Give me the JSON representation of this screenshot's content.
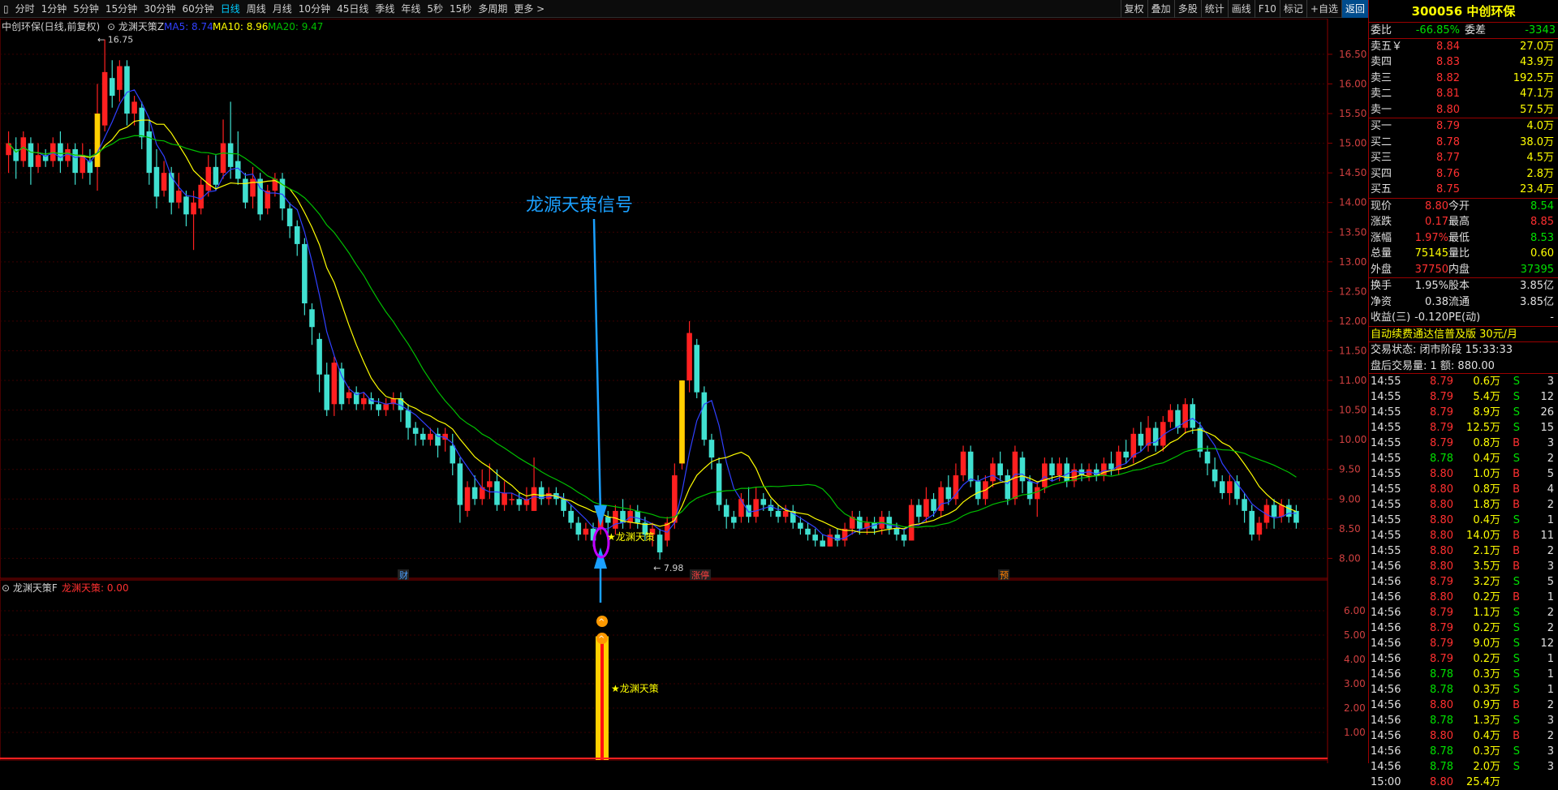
{
  "toolbar": {
    "left_icon": "▯",
    "periods": [
      "分时",
      "1分钟",
      "5分钟",
      "15分钟",
      "30分钟",
      "60分钟",
      "日线",
      "周线",
      "月线",
      "10分钟",
      "45日线",
      "季线",
      "年线",
      "5秒",
      "15秒",
      "多周期",
      "更多 >"
    ],
    "active": "日线",
    "right": [
      "复权",
      "叠加",
      "多股",
      "统计",
      "画线",
      "F10",
      "标记",
      "+自选",
      "返回"
    ]
  },
  "chart": {
    "header_name": "中创环保(日线,前复权)",
    "indicator_name": "龙渊天策Z",
    "ma5_label": "MA5: 8.74",
    "ma10_label": "MA10: 8.96",
    "ma20_label": "MA20: 9.47",
    "high_marker": "16.75",
    "low_marker": "7.98",
    "annotation": "龙源天策信号",
    "signal_label": "★龙渊天策",
    "event_tags": [
      "财",
      "涨停",
      "预"
    ],
    "y_ticks": [
      "16.50",
      "16.00",
      "15.50",
      "15.00",
      "14.50",
      "14.00",
      "13.50",
      "13.00",
      "12.50",
      "12.00",
      "11.50",
      "11.00",
      "10.50",
      "10.00",
      "9.50",
      "9.00",
      "8.50",
      "8.00"
    ],
    "colors": {
      "up": "#ff2020",
      "down": "#40e0d0",
      "ma5": "#3040ff",
      "ma10": "#ffff00",
      "ma20": "#00c000",
      "grid": "#3a0000",
      "accent": "#1aa0ff"
    }
  },
  "sub": {
    "name": "龙渊天策F",
    "value_label": "龙渊天策: 0.00",
    "signal_label": "★龙渊天策",
    "y_ticks": [
      "6.00",
      "5.00",
      "4.00",
      "3.00",
      "2.00",
      "1.00"
    ]
  },
  "chart_data": {
    "type": "candlestick",
    "title": "中创环保(日线,前复权)",
    "ylim": [
      7.8,
      16.8
    ],
    "candles": [
      [
        14.8,
        15.0,
        14.5,
        15.2
      ],
      [
        14.9,
        14.7,
        14.4,
        15.1
      ],
      [
        14.7,
        15.1,
        14.6,
        15.2
      ],
      [
        15.0,
        14.6,
        14.3,
        15.1
      ],
      [
        14.6,
        14.8,
        14.5,
        15.0
      ],
      [
        14.8,
        14.7,
        14.6,
        14.9
      ],
      [
        14.7,
        15.0,
        14.6,
        15.1
      ],
      [
        15.0,
        14.7,
        14.5,
        15.2
      ],
      [
        14.7,
        14.9,
        14.6,
        15.0
      ],
      [
        14.9,
        14.5,
        14.3,
        15.0
      ],
      [
        14.5,
        14.8,
        14.4,
        15.0
      ],
      [
        14.7,
        14.5,
        14.3,
        14.9
      ],
      [
        14.6,
        15.5,
        14.2,
        16.0
      ],
      [
        15.3,
        16.2,
        15.2,
        16.75
      ],
      [
        16.1,
        15.8,
        15.6,
        16.4
      ],
      [
        15.9,
        16.3,
        15.7,
        16.4
      ],
      [
        16.3,
        15.5,
        15.3,
        16.4
      ],
      [
        15.5,
        15.7,
        15.3,
        15.8
      ],
      [
        15.6,
        15.1,
        14.9,
        15.7
      ],
      [
        15.2,
        14.5,
        14.3,
        15.4
      ],
      [
        14.6,
        14.1,
        13.9,
        14.9
      ],
      [
        14.2,
        14.5,
        14.1,
        14.7
      ],
      [
        14.5,
        14.0,
        13.8,
        14.6
      ],
      [
        14.0,
        14.2,
        13.9,
        14.5
      ],
      [
        14.1,
        13.8,
        13.6,
        14.2
      ],
      [
        13.8,
        14.0,
        13.2,
        14.2
      ],
      [
        13.9,
        14.3,
        13.8,
        14.4
      ],
      [
        14.2,
        14.6,
        14.1,
        14.8
      ],
      [
        14.6,
        14.3,
        14.2,
        14.8
      ],
      [
        14.5,
        15.0,
        14.4,
        15.4
      ],
      [
        15.0,
        14.6,
        14.4,
        15.7
      ],
      [
        14.7,
        14.4,
        14.3,
        15.2
      ],
      [
        14.4,
        14.0,
        13.9,
        14.5
      ],
      [
        14.1,
        14.4,
        13.9,
        14.6
      ],
      [
        14.4,
        13.8,
        13.7,
        14.5
      ],
      [
        13.9,
        14.2,
        13.8,
        14.3
      ],
      [
        14.2,
        14.4,
        14.1,
        14.5
      ],
      [
        14.4,
        13.9,
        13.7,
        14.5
      ],
      [
        13.9,
        13.6,
        13.4,
        14.0
      ],
      [
        13.6,
        13.3,
        13.1,
        13.7
      ],
      [
        13.3,
        12.3,
        12.1,
        13.4
      ],
      [
        12.2,
        11.9,
        11.6,
        12.3
      ],
      [
        11.7,
        11.1,
        10.8,
        11.8
      ],
      [
        11.1,
        10.5,
        10.4,
        11.3
      ],
      [
        10.6,
        11.3,
        10.4,
        11.4
      ],
      [
        11.2,
        10.6,
        10.5,
        11.3
      ],
      [
        10.7,
        10.8,
        10.6,
        10.9
      ],
      [
        10.8,
        10.6,
        10.5,
        10.9
      ],
      [
        10.6,
        10.7,
        10.5,
        10.8
      ],
      [
        10.7,
        10.6,
        10.5,
        10.8
      ],
      [
        10.6,
        10.5,
        10.4,
        10.7
      ],
      [
        10.5,
        10.6,
        10.4,
        10.7
      ],
      [
        10.6,
        10.7,
        10.5,
        10.8
      ],
      [
        10.7,
        10.5,
        10.3,
        10.8
      ],
      [
        10.5,
        10.2,
        10.0,
        10.6
      ],
      [
        10.2,
        10.1,
        9.9,
        10.3
      ],
      [
        10.1,
        10.0,
        9.9,
        10.2
      ],
      [
        10.0,
        10.1,
        9.9,
        10.2
      ],
      [
        10.1,
        9.9,
        9.7,
        10.2
      ],
      [
        10.0,
        10.1,
        9.8,
        10.2
      ],
      [
        9.9,
        9.6,
        9.4,
        10.1
      ],
      [
        9.6,
        8.9,
        8.6,
        9.7
      ],
      [
        8.8,
        9.2,
        8.7,
        9.3
      ],
      [
        9.2,
        9.0,
        8.9,
        9.4
      ],
      [
        9.0,
        9.2,
        8.9,
        9.5
      ],
      [
        9.2,
        9.3,
        9.0,
        9.6
      ],
      [
        9.3,
        8.9,
        8.8,
        9.5
      ],
      [
        8.9,
        9.1,
        8.8,
        9.3
      ],
      [
        9.0,
        9.0,
        8.9,
        9.1
      ],
      [
        9.0,
        8.9,
        8.8,
        9.1
      ],
      [
        8.9,
        9.0,
        8.8,
        9.2
      ],
      [
        8.8,
        9.2,
        8.8,
        9.7
      ],
      [
        9.2,
        9.0,
        8.9,
        9.3
      ],
      [
        9.0,
        9.1,
        8.9,
        9.2
      ],
      [
        9.1,
        9.0,
        8.9,
        9.2
      ],
      [
        9.0,
        8.8,
        8.7,
        9.1
      ],
      [
        8.8,
        8.6,
        8.5,
        8.9
      ],
      [
        8.6,
        8.4,
        8.3,
        8.7
      ],
      [
        8.4,
        8.5,
        8.3,
        8.6
      ],
      [
        8.5,
        8.3,
        8.2,
        8.6
      ],
      [
        8.5,
        8.7,
        8.4,
        8.9
      ],
      [
        8.7,
        8.6,
        8.4,
        8.8
      ],
      [
        8.5,
        8.8,
        8.4,
        8.9
      ],
      [
        8.8,
        8.6,
        8.5,
        9.0
      ],
      [
        8.6,
        8.8,
        8.5,
        8.9
      ],
      [
        8.8,
        8.6,
        8.5,
        8.9
      ],
      [
        8.6,
        8.4,
        8.3,
        8.7
      ],
      [
        8.4,
        8.5,
        8.2,
        8.6
      ],
      [
        8.4,
        8.1,
        7.98,
        8.5
      ],
      [
        8.3,
        8.6,
        8.2,
        8.7
      ],
      [
        8.6,
        9.4,
        8.5,
        9.6
      ],
      [
        9.6,
        11.0,
        9.5,
        11.0
      ],
      [
        11.0,
        11.8,
        10.8,
        12.0
      ],
      [
        11.6,
        10.8,
        10.7,
        11.7
      ],
      [
        10.8,
        10.0,
        9.9,
        10.9
      ],
      [
        10.0,
        9.7,
        9.5,
        10.1
      ],
      [
        9.6,
        8.9,
        8.8,
        9.7
      ],
      [
        8.9,
        8.7,
        8.5,
        9.0
      ],
      [
        8.7,
        8.6,
        8.5,
        8.8
      ],
      [
        8.7,
        9.0,
        8.6,
        9.1
      ],
      [
        8.9,
        8.7,
        8.6,
        9.2
      ],
      [
        8.7,
        9.0,
        8.6,
        9.2
      ],
      [
        9.0,
        8.9,
        8.8,
        9.1
      ],
      [
        8.9,
        8.8,
        8.7,
        9.0
      ],
      [
        8.8,
        8.7,
        8.6,
        8.9
      ],
      [
        8.7,
        8.8,
        8.6,
        8.9
      ],
      [
        8.8,
        8.6,
        8.5,
        8.9
      ],
      [
        8.6,
        8.5,
        8.4,
        8.7
      ],
      [
        8.5,
        8.4,
        8.3,
        8.6
      ],
      [
        8.4,
        8.3,
        8.2,
        8.5
      ],
      [
        8.3,
        8.2,
        8.2,
        8.4
      ],
      [
        8.2,
        8.4,
        8.2,
        8.5
      ],
      [
        8.4,
        8.3,
        8.2,
        8.5
      ],
      [
        8.3,
        8.5,
        8.2,
        8.6
      ],
      [
        8.5,
        8.7,
        8.4,
        8.8
      ],
      [
        8.7,
        8.5,
        8.4,
        8.8
      ],
      [
        8.5,
        8.6,
        8.4,
        8.7
      ],
      [
        8.6,
        8.5,
        8.4,
        8.7
      ],
      [
        8.5,
        8.7,
        8.4,
        8.8
      ],
      [
        8.7,
        8.5,
        8.4,
        8.8
      ],
      [
        8.5,
        8.4,
        8.3,
        8.6
      ],
      [
        8.4,
        8.3,
        8.2,
        8.5
      ],
      [
        8.3,
        8.9,
        8.3,
        9.0
      ],
      [
        8.9,
        8.7,
        8.6,
        9.0
      ],
      [
        8.7,
        9.0,
        8.6,
        9.2
      ],
      [
        9.0,
        8.8,
        8.7,
        9.1
      ],
      [
        8.8,
        9.2,
        8.7,
        9.3
      ],
      [
        9.2,
        9.0,
        8.9,
        9.4
      ],
      [
        9.0,
        9.4,
        8.9,
        9.6
      ],
      [
        9.4,
        9.8,
        9.3,
        9.9
      ],
      [
        9.8,
        9.3,
        9.2,
        9.9
      ],
      [
        9.3,
        9.0,
        8.9,
        9.4
      ],
      [
        9.0,
        9.3,
        8.9,
        9.4
      ],
      [
        9.3,
        9.6,
        9.2,
        9.7
      ],
      [
        9.6,
        9.4,
        9.3,
        9.8
      ],
      [
        9.4,
        9.0,
        8.9,
        9.5
      ],
      [
        9.0,
        9.8,
        8.9,
        9.9
      ],
      [
        9.7,
        9.3,
        9.1,
        9.8
      ],
      [
        9.3,
        9.0,
        8.9,
        9.4
      ],
      [
        9.0,
        9.2,
        8.7,
        9.3
      ],
      [
        9.2,
        9.6,
        9.1,
        9.7
      ],
      [
        9.6,
        9.4,
        9.3,
        9.7
      ],
      [
        9.4,
        9.6,
        9.3,
        9.7
      ],
      [
        9.6,
        9.3,
        9.2,
        9.7
      ],
      [
        9.3,
        9.5,
        9.2,
        9.6
      ],
      [
        9.5,
        9.4,
        9.3,
        9.6
      ],
      [
        9.4,
        9.5,
        9.3,
        9.6
      ],
      [
        9.5,
        9.4,
        9.3,
        9.6
      ],
      [
        9.4,
        9.6,
        9.3,
        9.7
      ],
      [
        9.6,
        9.5,
        9.4,
        9.8
      ],
      [
        9.5,
        9.8,
        9.4,
        9.9
      ],
      [
        9.8,
        9.7,
        9.6,
        10.0
      ],
      [
        9.7,
        10.1,
        9.6,
        10.2
      ],
      [
        10.1,
        9.9,
        9.8,
        10.3
      ],
      [
        9.9,
        10.2,
        9.8,
        10.4
      ],
      [
        10.2,
        9.9,
        9.8,
        10.3
      ],
      [
        9.9,
        10.3,
        9.8,
        10.4
      ],
      [
        10.3,
        10.5,
        10.2,
        10.6
      ],
      [
        10.5,
        10.2,
        10.1,
        10.6
      ],
      [
        10.2,
        10.6,
        10.1,
        10.7
      ],
      [
        10.6,
        10.2,
        10.1,
        10.7
      ],
      [
        10.2,
        9.8,
        9.7,
        10.3
      ],
      [
        9.8,
        9.6,
        9.4,
        9.9
      ],
      [
        9.5,
        9.3,
        9.2,
        9.7
      ],
      [
        9.3,
        9.1,
        9.0,
        9.4
      ],
      [
        9.1,
        9.3,
        8.9,
        9.4
      ],
      [
        9.3,
        9.0,
        8.9,
        9.4
      ],
      [
        9.0,
        8.8,
        8.6,
        9.1
      ],
      [
        8.8,
        8.4,
        8.3,
        8.9
      ],
      [
        8.4,
        8.6,
        8.3,
        8.7
      ],
      [
        8.6,
        8.9,
        8.5,
        9.0
      ],
      [
        8.9,
        8.7,
        8.5,
        9.0
      ],
      [
        8.7,
        8.9,
        8.6,
        9.0
      ],
      [
        8.9,
        8.7,
        8.6,
        9.0
      ],
      [
        8.8,
        8.6,
        8.5,
        8.9
      ]
    ]
  },
  "sidebar": {
    "title": "300056 中创环保",
    "wb": {
      "l1": "委比",
      "v1": "-66.85%",
      "l2": "委差",
      "v2": "-3343"
    },
    "asks": [
      [
        "卖五￥",
        "8.84",
        "27.0万"
      ],
      [
        "卖四",
        "8.83",
        "43.9万"
      ],
      [
        "卖三",
        "8.82",
        "192.5万"
      ],
      [
        "卖二",
        "8.81",
        "47.1万"
      ],
      [
        "卖一",
        "8.80",
        "57.5万"
      ]
    ],
    "bids": [
      [
        "买一",
        "8.79",
        "4.0万"
      ],
      [
        "买二",
        "8.78",
        "38.0万"
      ],
      [
        "买三",
        "8.77",
        "4.5万"
      ],
      [
        "买四",
        "8.76",
        "2.8万"
      ],
      [
        "买五",
        "8.75",
        "23.4万"
      ]
    ],
    "quote": [
      [
        "现价",
        "8.80",
        "今开",
        "8.54"
      ],
      [
        "涨跌",
        "0.17",
        "最高",
        "8.85"
      ],
      [
        "涨幅",
        "1.97%",
        "最低",
        "8.53"
      ],
      [
        "总量",
        "75145",
        "量比",
        "0.60"
      ],
      [
        "外盘",
        "37750",
        "内盘",
        "37395"
      ]
    ],
    "fin": [
      [
        "换手",
        "1.95%",
        "股本",
        "3.85亿"
      ],
      [
        "净资",
        "0.38",
        "流通",
        "3.85亿"
      ],
      [
        "收益(三)",
        "-0.120",
        "PE(动)",
        "-"
      ]
    ],
    "ad": "自动续费通达信普及版  30元/月",
    "status": "交易状态: 闭市阶段 15:33:33",
    "after": "盘后交易量: 1  额: 880.00",
    "ticks": [
      [
        "14:55",
        "8.79",
        "0.6万",
        "S",
        "3"
      ],
      [
        "14:55",
        "8.79",
        "5.4万",
        "S",
        "12"
      ],
      [
        "14:55",
        "8.79",
        "8.9万",
        "S",
        "26"
      ],
      [
        "14:55",
        "8.79",
        "12.5万",
        "S",
        "15"
      ],
      [
        "14:55",
        "8.79",
        "0.8万",
        "B",
        "3"
      ],
      [
        "14:55",
        "8.78",
        "0.4万",
        "S",
        "2"
      ],
      [
        "14:55",
        "8.80",
        "1.0万",
        "B",
        "5"
      ],
      [
        "14:55",
        "8.80",
        "0.8万",
        "B",
        "4"
      ],
      [
        "14:55",
        "8.80",
        "1.8万",
        "B",
        "2"
      ],
      [
        "14:55",
        "8.80",
        "0.4万",
        "S",
        "1"
      ],
      [
        "14:55",
        "8.80",
        "14.0万",
        "B",
        "11"
      ],
      [
        "14:55",
        "8.80",
        "2.1万",
        "B",
        "2"
      ],
      [
        "14:56",
        "8.80",
        "3.5万",
        "B",
        "3"
      ],
      [
        "14:56",
        "8.79",
        "3.2万",
        "S",
        "5"
      ],
      [
        "14:56",
        "8.80",
        "0.2万",
        "B",
        "1"
      ],
      [
        "14:56",
        "8.79",
        "1.1万",
        "S",
        "2"
      ],
      [
        "14:56",
        "8.79",
        "0.2万",
        "S",
        "2"
      ],
      [
        "14:56",
        "8.79",
        "9.0万",
        "S",
        "12"
      ],
      [
        "14:56",
        "8.79",
        "0.2万",
        "S",
        "1"
      ],
      [
        "14:56",
        "8.78",
        "0.3万",
        "S",
        "1"
      ],
      [
        "14:56",
        "8.78",
        "0.3万",
        "S",
        "1"
      ],
      [
        "14:56",
        "8.80",
        "0.9万",
        "B",
        "2"
      ],
      [
        "14:56",
        "8.78",
        "1.3万",
        "S",
        "3"
      ],
      [
        "14:56",
        "8.80",
        "0.4万",
        "B",
        "2"
      ],
      [
        "14:56",
        "8.78",
        "0.3万",
        "S",
        "3"
      ],
      [
        "14:56",
        "8.78",
        "2.0万",
        "S",
        "3"
      ],
      [
        "15:00",
        "8.80",
        "25.4万",
        "",
        ""
      ]
    ]
  }
}
